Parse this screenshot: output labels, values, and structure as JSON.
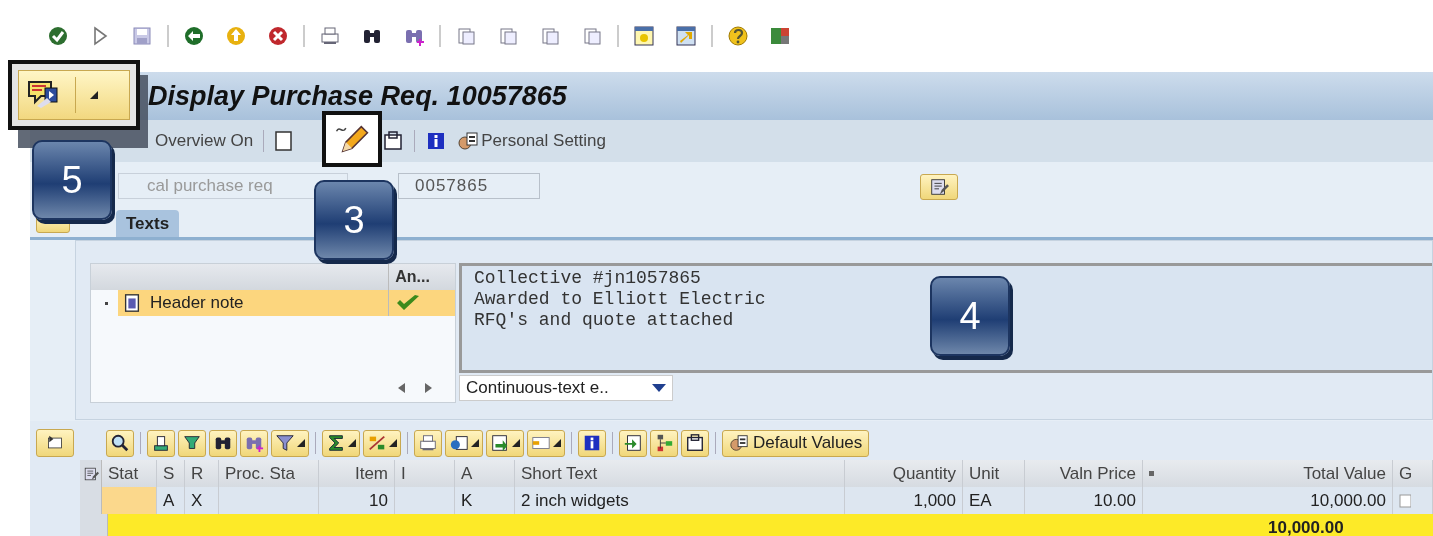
{
  "window": {
    "title": "Display Purchase Req. 10057865"
  },
  "app_toolbar": {
    "overview_button": "Overview On",
    "personal_setting": "Personal Setting"
  },
  "header": {
    "label": "cal purchase req",
    "value": "0057865"
  },
  "tabs": [
    {
      "label": "Texts",
      "selected": true
    }
  ],
  "text_tree": {
    "columns": [
      "An..."
    ],
    "rows": [
      {
        "label": "Header note",
        "selected": true,
        "checked": true
      }
    ]
  },
  "editor": {
    "lines": [
      "Collective #jn1057865",
      "Awarded to Elliott Electric",
      "RFQ's and quote attached"
    ],
    "format": "Continuous-text e.."
  },
  "grid": {
    "toolbar_button": "Default Values",
    "columns": [
      {
        "label": "Stat"
      },
      {
        "label": "S",
        "cell": "A"
      },
      {
        "label": "R",
        "cell": "X"
      },
      {
        "label": "Proc. Sta"
      },
      {
        "label": "Item",
        "cell": "10"
      },
      {
        "label": "I"
      },
      {
        "label": "A",
        "cell": "K"
      },
      {
        "label": "Short Text",
        "cell": "2 inch widgets"
      },
      {
        "label": "Quantity",
        "cell": "1,000"
      },
      {
        "label": "Unit",
        "cell": "EA"
      },
      {
        "label": "Valn Price",
        "cell": "10.00"
      },
      {
        "label": "Total Value",
        "cell": "10,000.00"
      },
      {
        "label": "G"
      }
    ],
    "total": "10,000.00"
  },
  "callouts": [
    {
      "label": "5"
    },
    {
      "label": "3"
    },
    {
      "label": "4"
    }
  ]
}
